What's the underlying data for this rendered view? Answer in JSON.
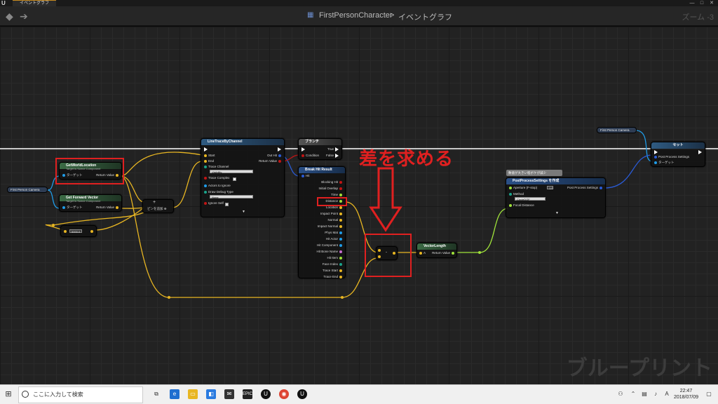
{
  "window": {
    "tab_title": "イベントグラフ",
    "logo": "U"
  },
  "header": {
    "breadcrumb_root": "FirstPersonCharacter",
    "breadcrumb_sep": ">",
    "breadcrumb_leaf": "イベントグラフ",
    "zoom": "ズーム -3"
  },
  "watermark": "ブループリント",
  "annotation": {
    "text": "差を求める"
  },
  "nodes": {
    "get_world_location": {
      "title": "GetWorldLocation",
      "subtitle": "Target is Scene Component",
      "pin_target": "ターゲット",
      "pin_return": "Return Value"
    },
    "get_forward_vector": {
      "title": "Get Forward Vector",
      "subtitle": "Target is Scene Component",
      "pin_target": "ターゲット",
      "pin_return": "Return Value"
    },
    "first_person_camera_left": {
      "label": "First Person Camera"
    },
    "multiply_value": {
      "value": "5000.0"
    },
    "add_node": {
      "label": "ピンを追加 ⊕"
    },
    "line_trace": {
      "title": "LineTraceByChannel",
      "pin_start": "Start",
      "pin_end": "End",
      "pin_trace_channel": "Trace Channel",
      "trace_channel_value": "Visibility",
      "pin_trace_complex": "Trace Complex",
      "pin_actors_ignore": "Actors to Ignore",
      "pin_draw_debug": "Draw Debug Type",
      "draw_debug_value": "None",
      "pin_ignore_self": "Ignore Self",
      "pin_out_hit": "Out Hit",
      "pin_return": "Return Value"
    },
    "branch": {
      "title": "ブランチ",
      "pin_condition": "Condition",
      "pin_true": "True",
      "pin_false": "False"
    },
    "break_hit": {
      "title": "Break Hit Result",
      "pin_hit": "Hit",
      "outputs": [
        "Blocking Hit",
        "Initial Overlap",
        "Time",
        "Distance",
        "Location",
        "Impact Point",
        "Normal",
        "Impact Normal",
        "Phys Mat",
        "Hit Actor",
        "Hit Component",
        "Hit Bone Name",
        "Hit Item",
        "Face Index",
        "Trace Start",
        "Trace End"
      ]
    },
    "subtract": {
      "label": "-"
    },
    "vector_length": {
      "title": "VectorLength",
      "pin_a": "A",
      "pin_return": "Return Value"
    },
    "post_process": {
      "comment": "数値が大きい程ボケが減少",
      "title": "PostProcessSettings を作成",
      "pin_aperture": "Aperture (F-stop)",
      "aperture_value": "1.0",
      "pin_method": "Method",
      "method_value": "CircleDOF",
      "pin_focal": "Focal Distance",
      "pin_out": "Post Process Settings"
    },
    "first_person_camera_right": {
      "label": "First Person Camera"
    },
    "set_node": {
      "title": "セット",
      "pin_settings": "Post Process Settings",
      "pin_target": "ターゲット"
    }
  },
  "taskbar": {
    "search_placeholder": "ここに入力して検索",
    "time": "22:47",
    "date": "2018/07/09"
  },
  "colors": {
    "vector_wire": "#e8b622",
    "float_wire": "#9fe23a",
    "object_wire": "#1f9ce8",
    "exec_wire": "#ffffff",
    "struct_wire": "#2a5bd6",
    "annotation_red": "#e02020"
  }
}
